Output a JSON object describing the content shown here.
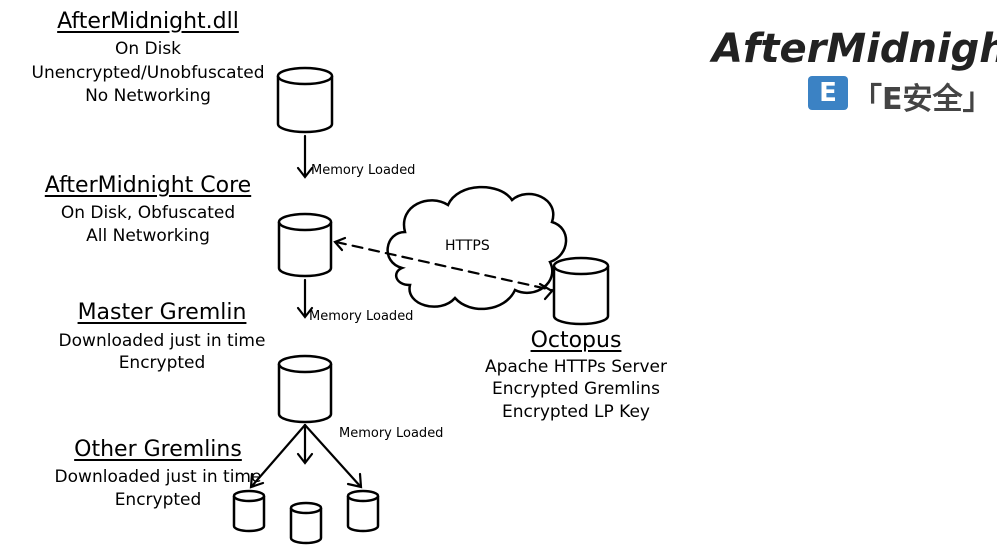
{
  "brand": {
    "title": "AfterMidnight",
    "logo_mark": "E",
    "logo_text": "「E安全」"
  },
  "components": {
    "dll": {
      "title": "AfterMidnight.dll",
      "line1": "On Disk",
      "line2": "Unencrypted/Unobfuscated",
      "line3": "No Networking"
    },
    "core": {
      "title": "AfterMidnight Core",
      "line1": "On Disk, Obfuscated",
      "line2": "All Networking"
    },
    "master": {
      "title": "Master Gremlin",
      "line1": "Downloaded just in time",
      "line2": "Encrypted"
    },
    "others": {
      "title": "Other Gremlins",
      "line1": "Downloaded just in time",
      "line2": "Encrypted"
    },
    "octopus": {
      "title": "Octopus",
      "line1": "Apache HTTPs Server",
      "line2": "Encrypted Gremlins",
      "line3": "Encrypted LP Key"
    }
  },
  "edges": {
    "dll_to_core": "Memory Loaded",
    "core_to_master": "Memory Loaded",
    "master_to_others": "Memory Loaded",
    "cloud": "HTTPS"
  }
}
